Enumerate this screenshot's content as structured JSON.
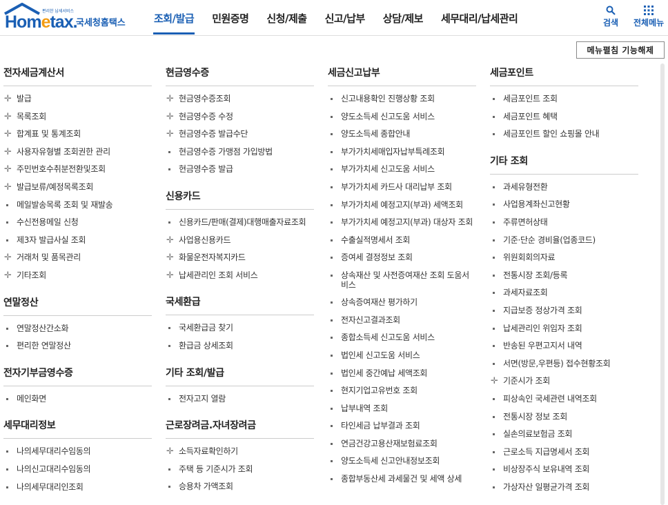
{
  "header": {
    "logo": {
      "brand_main": "Hom",
      "brand_e": "e",
      "brand_tail": "tax.",
      "tagline": "편리한 납세서비스",
      "name": "국세청홈택스"
    },
    "nav": [
      "조회/발급",
      "민원증명",
      "신청/제출",
      "신고/납부",
      "상담/제보",
      "세무대리/납세관리"
    ],
    "active_nav": "조회/발급",
    "search_label": "검색",
    "all_menu_label": "전체메뉴"
  },
  "collapse_button": "메뉴펼침 기능해제",
  "colors": {
    "brand": "#1a5fb4",
    "accent": "#f39c12"
  },
  "columns": [
    {
      "sections": [
        {
          "title": "전자세금계산서",
          "items": [
            {
              "label": "발급",
              "icon": "plus"
            },
            {
              "label": "목록조회",
              "icon": "plus"
            },
            {
              "label": "합계표 및 통계조회",
              "icon": "plus"
            },
            {
              "label": "사용자유형별 조회권한 관리",
              "icon": "plus"
            },
            {
              "label": "주민번호수취분전환및조회",
              "icon": "plus"
            },
            {
              "label": "발급보류/예정목록조회",
              "icon": "plus"
            },
            {
              "label": "메일발송목록 조회 및 재발송",
              "icon": "square"
            },
            {
              "label": "수신전용메일 신청",
              "icon": "square"
            },
            {
              "label": "제3자 발급사실 조회",
              "icon": "square"
            },
            {
              "label": "거래처 및 품목관리",
              "icon": "plus"
            },
            {
              "label": "기타조회",
              "icon": "plus"
            }
          ]
        },
        {
          "title": "연말정산",
          "items": [
            {
              "label": "연말정산간소화",
              "icon": "square"
            },
            {
              "label": "편리한 연말정산",
              "icon": "square"
            }
          ]
        },
        {
          "title": "전자기부금영수증",
          "items": [
            {
              "label": "메인화면",
              "icon": "square"
            }
          ]
        },
        {
          "title": "세무대리정보",
          "items": [
            {
              "label": "나의세무대리수임동의",
              "icon": "square"
            },
            {
              "label": "나의신고대리수임동의",
              "icon": "square"
            },
            {
              "label": "나의세무대리인조회",
              "icon": "square"
            }
          ]
        }
      ]
    },
    {
      "sections": [
        {
          "title": "현금영수증",
          "items": [
            {
              "label": "현금영수증조회",
              "icon": "plus"
            },
            {
              "label": "현금영수증 수정",
              "icon": "plus"
            },
            {
              "label": "현금영수증 발급수단",
              "icon": "plus"
            },
            {
              "label": "현금영수증 가맹점 가입방법",
              "icon": "square"
            },
            {
              "label": "현금영수증 발급",
              "icon": "square"
            }
          ]
        },
        {
          "title": "신용카드",
          "items": [
            {
              "label": "신용카드/판매(결제)대행매출자료조회",
              "icon": "square"
            },
            {
              "label": "사업용신용카드",
              "icon": "plus"
            },
            {
              "label": "화물운전자복지카드",
              "icon": "plus"
            },
            {
              "label": "납세관리인 조회 서비스",
              "icon": "plus"
            }
          ]
        },
        {
          "title": "국세환급",
          "items": [
            {
              "label": "국세환급금 찾기",
              "icon": "square"
            },
            {
              "label": "환급금 상세조회",
              "icon": "square"
            }
          ]
        },
        {
          "title": "기타 조회/발급",
          "items": [
            {
              "label": "전자고지 열람",
              "icon": "square"
            }
          ]
        },
        {
          "title": "근로장려금.자녀장려금",
          "items": [
            {
              "label": "소득자료확인하기",
              "icon": "plus"
            },
            {
              "label": "주택 등 기준시가 조회",
              "icon": "square"
            },
            {
              "label": "승용차 가액조회",
              "icon": "square"
            }
          ]
        }
      ]
    },
    {
      "sections": [
        {
          "title": "세금신고납부",
          "items": [
            {
              "label": "신고내용확인 진행상황 조회",
              "icon": "square"
            },
            {
              "label": "양도소득세 신고도움 서비스",
              "icon": "square"
            },
            {
              "label": "양도소득세 종합안내",
              "icon": "square"
            },
            {
              "label": "부가가치세매입자납부특례조회",
              "icon": "square"
            },
            {
              "label": "부가가치세 신고도움 서비스",
              "icon": "square"
            },
            {
              "label": "부가가치세 카드사 대리납부 조회",
              "icon": "square"
            },
            {
              "label": "부가가치세 예정고지(부과) 세액조회",
              "icon": "square"
            },
            {
              "label": "부가가치세 예정고지(부과) 대상자 조회",
              "icon": "square"
            },
            {
              "label": "수출실적명세서 조회",
              "icon": "square"
            },
            {
              "label": "증여세 결정정보 조회",
              "icon": "square"
            },
            {
              "label": "상속재산 및 사전증여재산 조회 도움서비스",
              "icon": "square"
            },
            {
              "label": "상속증여재산 평가하기",
              "icon": "square"
            },
            {
              "label": "전자신고결과조회",
              "icon": "square"
            },
            {
              "label": "종합소득세 신고도움 서비스",
              "icon": "square"
            },
            {
              "label": "법인세 신고도움 서비스",
              "icon": "square"
            },
            {
              "label": "법인세 중간예납 세액조회",
              "icon": "square"
            },
            {
              "label": "현지기업고유번호 조회",
              "icon": "square"
            },
            {
              "label": "납부내역 조회",
              "icon": "square"
            },
            {
              "label": "타인세금 납부결과 조회",
              "icon": "square"
            },
            {
              "label": "연금건강고용산재보험료조회",
              "icon": "square"
            },
            {
              "label": "양도소득세 신고안내정보조회",
              "icon": "square"
            },
            {
              "label": "종합부동산세 과세물건 및 세액 상세",
              "icon": "square"
            }
          ]
        }
      ]
    },
    {
      "sections": [
        {
          "title": "세금포인트",
          "items": [
            {
              "label": "세금포인트 조회",
              "icon": "square"
            },
            {
              "label": "세금포인트 혜택",
              "icon": "square"
            },
            {
              "label": "세금포인트 할인 쇼핑몰 안내",
              "icon": "square"
            }
          ]
        },
        {
          "title": "기타 조회",
          "items": [
            {
              "label": "과세유형전환",
              "icon": "square"
            },
            {
              "label": "사업용계좌신고현황",
              "icon": "square"
            },
            {
              "label": "주류면허상태",
              "icon": "square"
            },
            {
              "label": "기준·단순 경비율(업종코드)",
              "icon": "square"
            },
            {
              "label": "위원회회의자료",
              "icon": "square"
            },
            {
              "label": "전통시장 조회/등록",
              "icon": "square"
            },
            {
              "label": "과세자료조회",
              "icon": "square"
            },
            {
              "label": "지급보증 정상가격 조회",
              "icon": "square"
            },
            {
              "label": "납세관리인 위임자 조회",
              "icon": "square"
            },
            {
              "label": "반송된 우편고지서 내역",
              "icon": "square"
            },
            {
              "label": "서면(방문,우편등) 접수현황조회",
              "icon": "square"
            },
            {
              "label": "기준시가 조회",
              "icon": "plus"
            },
            {
              "label": "피상속인 국세관련 내역조회",
              "icon": "square"
            },
            {
              "label": "전통시장 정보 조회",
              "icon": "square"
            },
            {
              "label": "실손의료보험금 조회",
              "icon": "square"
            },
            {
              "label": "근로소득 지급명세서 조회",
              "icon": "square"
            },
            {
              "label": "비상장주식 보유내역 조회",
              "icon": "square"
            },
            {
              "label": "가상자산 일평균가격 조회",
              "icon": "square"
            }
          ]
        }
      ]
    }
  ]
}
